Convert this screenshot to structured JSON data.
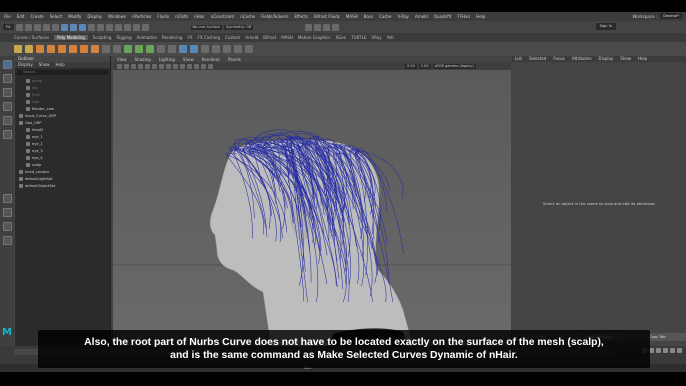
{
  "menubar": {
    "items": [
      "File",
      "Edit",
      "Create",
      "Select",
      "Modify",
      "Display",
      "Windows",
      "nParticles",
      "Fluids",
      "nCloth",
      "nHair",
      "nConstraint",
      "nCache",
      "Fields/Solvers",
      "Effects",
      "Bifrost Fluids",
      "MASH",
      "Boss",
      "Cache",
      "V-Ray",
      "Arnold",
      "Quadrifit",
      "FFHair",
      "Help"
    ],
    "workspace_label": "Workspace :",
    "workspace_value": "General*"
  },
  "statusline": {
    "mode": "FX",
    "symmetry": "Symmetry: Off",
    "live_surface": "No Live Surface",
    "sign_in": "Sign In"
  },
  "shelf": {
    "tabs": [
      "Curves / Surfaces",
      "Poly Modeling",
      "Sculpting",
      "Rigging",
      "Animation",
      "Rendering",
      "FX",
      "FX Caching",
      "Custom",
      "Arnold",
      "Bifrost",
      "MASH",
      "Motion Graphics",
      "XGen",
      "TURTLE",
      "VRay",
      "Yeti"
    ],
    "active_tab": "Poly Modeling"
  },
  "outliner": {
    "title": "Outliner",
    "menu": [
      "Display",
      "Show",
      "Help"
    ],
    "search_placeholder": "Search...",
    "items": [
      {
        "label": "persp",
        "depth": 1,
        "dim": true
      },
      {
        "label": "top",
        "depth": 1,
        "dim": true
      },
      {
        "label": "front",
        "depth": 1,
        "dim": true
      },
      {
        "label": "side",
        "depth": 1,
        "dim": true
      },
      {
        "label": "Render_cam",
        "depth": 1,
        "dim": false
      },
      {
        "label": "Input_Curve_GRP",
        "depth": 0,
        "dim": false
      },
      {
        "label": "Geo_GRP",
        "depth": 0,
        "dim": false
      },
      {
        "label": "head2",
        "depth": 1,
        "dim": false
      },
      {
        "label": "eye_1",
        "depth": 1,
        "dim": false
      },
      {
        "label": "eye_2",
        "depth": 1,
        "dim": false
      },
      {
        "label": "eye_3",
        "depth": 1,
        "dim": false
      },
      {
        "label": "eye_4",
        "depth": 1,
        "dim": false
      },
      {
        "label": "scalp",
        "depth": 1,
        "dim": false
      },
      {
        "label": "head_Locator",
        "depth": 0,
        "dim": false
      },
      {
        "label": "defaultLightSet",
        "depth": 0,
        "dim": false
      },
      {
        "label": "defaultObjectSet",
        "depth": 0,
        "dim": false
      }
    ]
  },
  "viewport": {
    "menu": [
      "View",
      "Shading",
      "Lighting",
      "Show",
      "Renderer",
      "Panels"
    ],
    "exposure": "0.00",
    "gamma": "1.00",
    "color_space": "sRGB gamma (legacy)",
    "camera_label": "side -X",
    "hair_color": "#2a2fa0"
  },
  "attribute_editor": {
    "menu": [
      "List",
      "Selected",
      "Focus",
      "Attributes",
      "Display",
      "Show",
      "Help"
    ],
    "message": "Select an object in the scene to view and edit its attributes",
    "buttons": [
      "Select",
      "Load Attributes",
      "Copy Tab"
    ]
  },
  "helpline": {
    "label": "MEL"
  },
  "subtitle": {
    "line1": "Also, the root part of Nurbs Curve does not have to be located exactly on the surface of the mesh (scalp),",
    "line2": "and is the same command as Make Selected Curves Dynamic of nHair."
  }
}
